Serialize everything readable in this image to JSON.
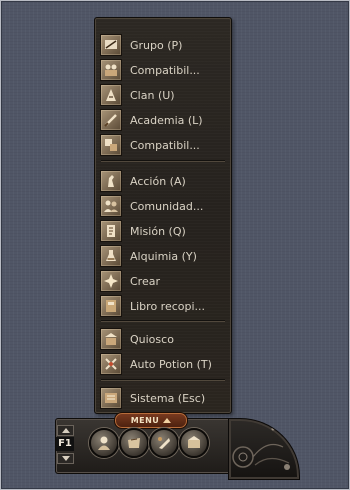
{
  "menu": {
    "tab_label": "MENU",
    "groups": [
      [
        {
          "label": "Grupo (P)",
          "icon": "group-icon"
        },
        {
          "label": "Compatibil...",
          "icon": "compatibility-icon"
        },
        {
          "label": "Clan (U)",
          "icon": "clan-icon"
        },
        {
          "label": "Academia (L)",
          "icon": "academy-icon"
        },
        {
          "label": "Compatibil...",
          "icon": "compatibility-icon"
        }
      ],
      [
        {
          "label": "Acción (A)",
          "icon": "action-icon"
        },
        {
          "label": "Comunidad...",
          "icon": "community-icon"
        },
        {
          "label": "Misión (Q)",
          "icon": "quest-icon"
        },
        {
          "label": "Alquimia (Y)",
          "icon": "alchemy-icon"
        },
        {
          "label": "Crear",
          "icon": "craft-icon"
        },
        {
          "label": "Libro recopi...",
          "icon": "book-icon"
        }
      ],
      [
        {
          "label": "Quiosco",
          "icon": "kiosk-icon"
        },
        {
          "label": "Auto Potion (T)",
          "icon": "potion-icon"
        }
      ],
      [
        {
          "label": "Sistema (Esc)",
          "icon": "system-icon"
        }
      ]
    ]
  },
  "quickbar": {
    "slot_label": "F1",
    "buttons": [
      {
        "icon": "character-icon"
      },
      {
        "icon": "inventory-icon"
      },
      {
        "icon": "skills-icon"
      },
      {
        "icon": "map-icon"
      }
    ]
  },
  "colors": {
    "background": "#505666",
    "panel": "#28241f",
    "text": "#dad3c5",
    "menu_tab": "#6a2f17"
  }
}
